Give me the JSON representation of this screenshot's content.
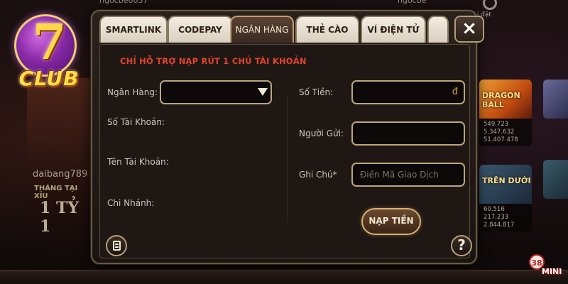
{
  "background": {
    "top_user_left": "hgocbe0037",
    "top_user_right": "hgocbe",
    "settings_label": "Cài đặt",
    "left_card": {
      "name": "daibang789",
      "promo": "THÁNG TẠI XỈU",
      "prize": "1 TỶ 1"
    },
    "right_cards": [
      {
        "title": "DRAGON BALL",
        "numbers": [
          "549.723",
          "5.347.632",
          "51.407.478"
        ]
      },
      {
        "title": "TRÊN DƯỚI",
        "numbers": [
          "60.516",
          "217.233",
          "2.844.817"
        ]
      }
    ]
  },
  "logo": {
    "number": "7",
    "text": "CLUB"
  },
  "tabs": [
    {
      "label": "SMARTLINK",
      "active": false
    },
    {
      "label": "CODEPAY",
      "active": false
    },
    {
      "label": "NGÂN HÀNG",
      "active": true
    },
    {
      "label": "THẺ CÀO",
      "active": false
    },
    {
      "label": "VÍ ĐIỆN TỬ",
      "active": false
    }
  ],
  "close_label": "×",
  "form": {
    "notice": "CHỈ HỖ TRỢ NẠP RÚT 1 CHỦ TÀI KHOẢN",
    "bank_label": "Ngân Hàng:",
    "bank_value": "",
    "account_number_label": "Số Tài Khoản:",
    "account_name_label": "Tên Tài Khoản:",
    "branch_label": "Chi Nhánh:",
    "amount_label": "Số Tiền:",
    "amount_value": "",
    "currency": "đ",
    "sender_label": "Người Gửi:",
    "sender_value": "",
    "note_label": "Ghi Chú*",
    "note_placeholder": "Điền Mã Giao Dịch",
    "submit_label": "NẠP TIỀN",
    "help_label": "?"
  },
  "mini": {
    "count": "38",
    "label": "MINI"
  }
}
